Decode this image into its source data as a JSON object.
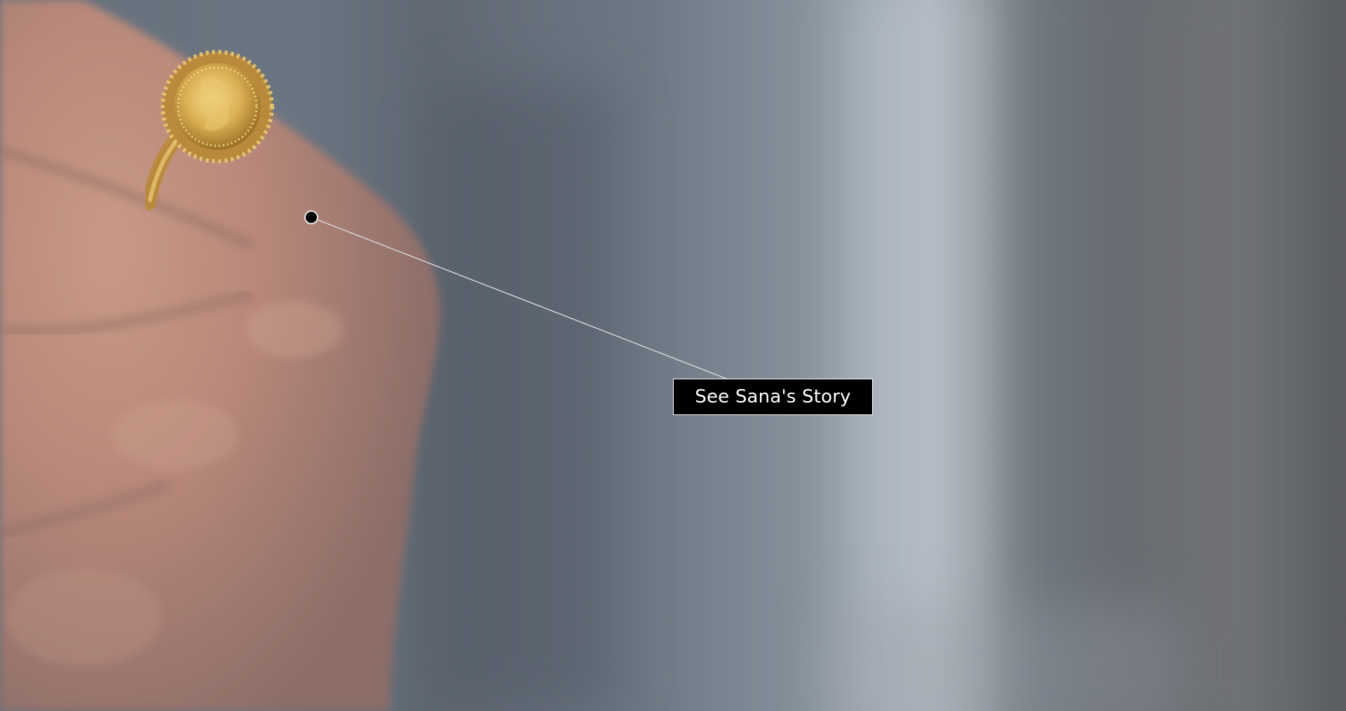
{
  "hotspot": {
    "label": "See Sana's Story"
  },
  "colors": {
    "button_background": "#000000",
    "button_text": "#ffffff",
    "button_border": "#ffffff",
    "leader_line": "#d8dadc",
    "ring_gold": "#c9a24a"
  },
  "icons": {
    "hotspot_marker": "hotspot-dot-icon"
  }
}
